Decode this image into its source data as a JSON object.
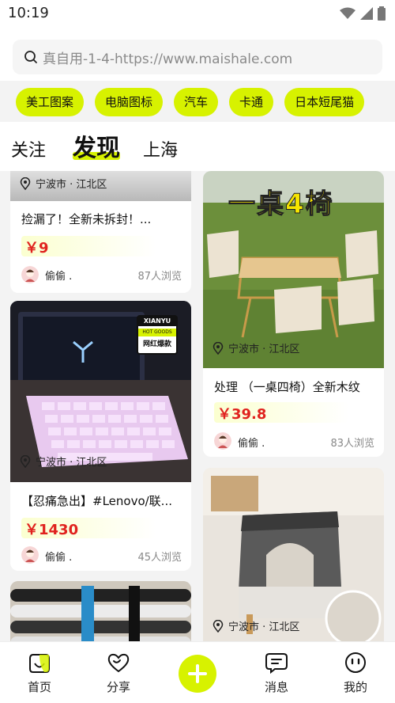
{
  "status": {
    "time": "10:19"
  },
  "search": {
    "placeholder": "真自用-1-4-https://www.maishale.com"
  },
  "chips": [
    "美工图案",
    "电脑图标",
    "汽车",
    "卡通",
    "日本短尾猫"
  ],
  "tabs": {
    "follow": "关注",
    "discover": "发现",
    "city": "上海"
  },
  "cards": {
    "c1": {
      "location": "宁波市 · 江北区",
      "title": "捡漏了！全新未拆封！...",
      "price": "￥9",
      "user": "偷偷 .",
      "views": "87人浏览"
    },
    "c2": {
      "location": "宁波市 · 江北区",
      "title": "【忍痛急出】#Lenovo/联...",
      "price": "￥1430",
      "user": "偷偷 .",
      "views": "45人浏览",
      "sticker_brand": "XIANYU",
      "sticker_tag": "HOT GOODS",
      "sticker_text": "网红爆款"
    },
    "c3": {
      "location": "宁波市 · 江北区",
      "title": "处理 （一桌四椅）全新木纹",
      "price": "￥39.8",
      "user": "偷偷 .",
      "views": "83人浏览",
      "overlay_text": "一桌4椅"
    },
    "c4": {
      "location": "宁波市 · 江北区"
    }
  },
  "nav": {
    "home": "首页",
    "share": "分享",
    "messages": "消息",
    "mine": "我的"
  },
  "colors": {
    "accent": "#d7f200",
    "price": "#e0221e"
  }
}
